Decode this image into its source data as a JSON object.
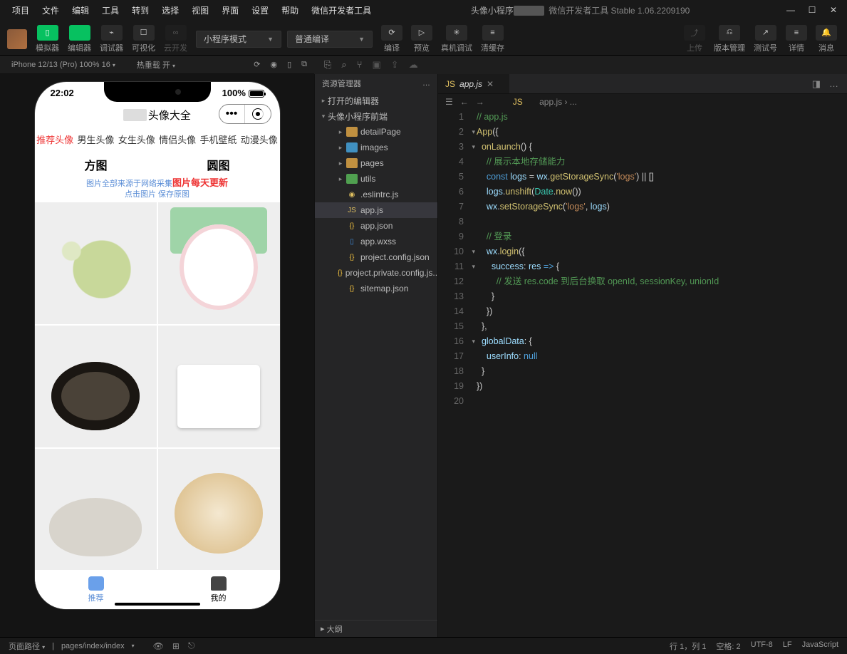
{
  "menubar": {
    "items": [
      "项目",
      "文件",
      "编辑",
      "工具",
      "转到",
      "选择",
      "视图",
      "界面",
      "设置",
      "帮助",
      "微信开发者工具"
    ],
    "project_name": "头像小程序",
    "version": "微信开发者工具 Stable 1.06.2209190"
  },
  "toolbar": {
    "buttons": [
      {
        "icon": "▯",
        "label": "模拟器",
        "green": true
      },
      {
        "icon": "</>",
        "label": "编辑器",
        "green": true
      },
      {
        "icon": "⌁",
        "label": "调试器"
      },
      {
        "icon": "☐",
        "label": "可视化"
      },
      {
        "icon": "∞",
        "label": "云开发",
        "dim": true
      }
    ],
    "select1": "小程序模式",
    "select2": "普通编译",
    "actions": [
      {
        "icon": "⟳",
        "label": "编译"
      },
      {
        "icon": "▷",
        "label": "预览"
      },
      {
        "icon": "✳",
        "label": "真机调试"
      },
      {
        "icon": "≡",
        "label": "清缓存"
      }
    ],
    "right": [
      {
        "icon": "⤴",
        "label": "上传",
        "dim": true
      },
      {
        "icon": "⎌",
        "label": "版本管理"
      },
      {
        "icon": "↗",
        "label": "测试号"
      },
      {
        "icon": "≡",
        "label": "详情"
      },
      {
        "icon": "🔔",
        "label": "消息"
      }
    ]
  },
  "sim": {
    "device": "iPhone 12/13 (Pro) 100% 16",
    "hot": "热重载 开",
    "phone": {
      "time": "22:02",
      "battery": "100%",
      "title_suffix": "头像大全",
      "tabs": [
        "推荐头像",
        "男生头像",
        "女生头像",
        "情侣头像",
        "手机壁纸",
        "动漫头像"
      ],
      "shape_square": "方图",
      "shape_round": "圆图",
      "info1": "图片全部来源于网络采集",
      "info_red": "图片每天更新",
      "info2": "点击图片 保存原图",
      "tabbar": [
        {
          "label": "推荐",
          "color": "#5a8dd6"
        },
        {
          "label": "我的",
          "color": "#333"
        }
      ]
    }
  },
  "explorer": {
    "title": "资源管理器",
    "open_editors": "打开的编辑器",
    "project": "头像小程序前端",
    "tree": [
      {
        "icon": "fold-y",
        "label": "detailPage",
        "chev": "▸",
        "ind": 2
      },
      {
        "icon": "fold-b",
        "label": "images",
        "chev": "▸",
        "ind": 2
      },
      {
        "icon": "fold-y",
        "label": "pages",
        "chev": "▸",
        "ind": 2
      },
      {
        "icon": "fold-g",
        "label": "utils",
        "chev": "▸",
        "ind": 2
      },
      {
        "icon": "js",
        "label": ".eslintrc.js",
        "ind": 2,
        "glyph": "◉"
      },
      {
        "icon": "js",
        "label": "app.js",
        "ind": 2,
        "sel": true,
        "glyph": "JS"
      },
      {
        "icon": "json",
        "label": "app.json",
        "ind": 2,
        "glyph": "{}"
      },
      {
        "icon": "wxss",
        "label": "app.wxss",
        "ind": 2,
        "glyph": "▯"
      },
      {
        "icon": "json",
        "label": "project.config.json",
        "ind": 2,
        "glyph": "{}"
      },
      {
        "icon": "json",
        "label": "project.private.config.js...",
        "ind": 2,
        "glyph": "{}"
      },
      {
        "icon": "json",
        "label": "sitemap.json",
        "ind": 2,
        "glyph": "{}"
      }
    ],
    "outline": "大纲"
  },
  "editor": {
    "tab": "app.js",
    "crumb": "app.js › ...",
    "lines": [
      {
        "n": 1,
        "html": "<span class='cm'>// app.js</span>"
      },
      {
        "n": 2,
        "html": "<span class='fn'>App</span><span class='op'>({</span>",
        "chev": "▾"
      },
      {
        "n": 3,
        "html": "  <span class='fn'>onLaunch</span><span class='op'>() {</span>",
        "chev": "▾"
      },
      {
        "n": 4,
        "html": "    <span class='cm'>// 展示本地存储能力</span>"
      },
      {
        "n": 5,
        "html": "    <span class='kw'>const</span> <span class='id'>logs</span> <span class='op'>=</span> <span class='id'>wx</span><span class='op'>.</span><span class='fn'>getStorageSync</span><span class='op'>(</span><span class='str'>'logs'</span><span class='op'>) || []</span>"
      },
      {
        "n": 6,
        "html": "    <span class='id'>logs</span><span class='op'>.</span><span class='fn'>unshift</span><span class='op'>(</span><span class='builtin'>Date</span><span class='op'>.</span><span class='fn'>now</span><span class='op'>())</span>"
      },
      {
        "n": 7,
        "html": "    <span class='id'>wx</span><span class='op'>.</span><span class='fn'>setStorageSync</span><span class='op'>(</span><span class='str'>'logs'</span><span class='op'>,</span> <span class='id'>logs</span><span class='op'>)</span>"
      },
      {
        "n": 8,
        "html": ""
      },
      {
        "n": 9,
        "html": "    <span class='cm'>// 登录</span>"
      },
      {
        "n": 10,
        "html": "    <span class='id'>wx</span><span class='op'>.</span><span class='fn'>login</span><span class='op'>({</span>",
        "chev": "▾"
      },
      {
        "n": 11,
        "html": "      <span class='id'>success</span><span class='op'>:</span> <span class='id'>res</span> <span class='kw'>=&gt;</span> <span class='op'>{</span>",
        "chev": "▾"
      },
      {
        "n": 12,
        "html": "        <span class='cm'>// 发送 res.code 到后台换取 openId, sessionKey, unionId</span>"
      },
      {
        "n": 13,
        "html": "      <span class='op'>}</span>"
      },
      {
        "n": 14,
        "html": "    <span class='op'>})</span>"
      },
      {
        "n": 15,
        "html": "  <span class='op'>},</span>"
      },
      {
        "n": 16,
        "html": "  <span class='id'>globalData</span><span class='op'>: {</span>",
        "chev": "▾"
      },
      {
        "n": 17,
        "html": "    <span class='id'>userInfo</span><span class='op'>:</span> <span class='kw'>null</span>"
      },
      {
        "n": 18,
        "html": "  <span class='op'>}</span>"
      },
      {
        "n": 19,
        "html": "<span class='op'>})</span>"
      },
      {
        "n": 20,
        "html": ""
      }
    ]
  },
  "statusbar": {
    "path_label": "页面路径",
    "path": "pages/index/index",
    "right": [
      "行 1，列 1",
      "空格: 2",
      "UTF-8",
      "LF",
      "JavaScript"
    ]
  }
}
